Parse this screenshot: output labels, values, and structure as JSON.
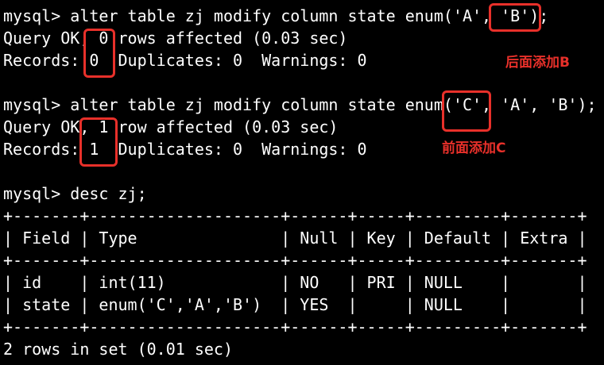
{
  "terminal": {
    "lines": [
      "mysql> alter table zj modify column state enum('A', 'B');",
      "Query OK, 0 rows affected (0.03 sec)",
      "Records: 0  Duplicates: 0  Warnings: 0",
      "",
      "mysql> alter table zj modify column state enum('C', 'A', 'B');",
      "Query OK, 1 row affected (0.03 sec)",
      "Records: 1  Duplicates: 0  Warnings: 0",
      "",
      "mysql> desc zj;",
      "+-------+--------------------+------+-----+---------+-------+",
      "| Field | Type               | Null | Key | Default | Extra |",
      "+-------+--------------------+------+-----+---------+-------+",
      "| id    | int(11)            | NO   | PRI | NULL    |       |",
      "| state | enum('C','A','B')  | YES  |     | NULL    |       |",
      "+-------+--------------------+------+-----+---------+-------+",
      "2 rows in set (0.01 sec)"
    ]
  },
  "annotations": {
    "append_b": "后面添加B",
    "prepend_c": "前面添加C"
  },
  "colors": {
    "background": "#000000",
    "text": "#ffffff",
    "highlight": "#e8302a"
  }
}
